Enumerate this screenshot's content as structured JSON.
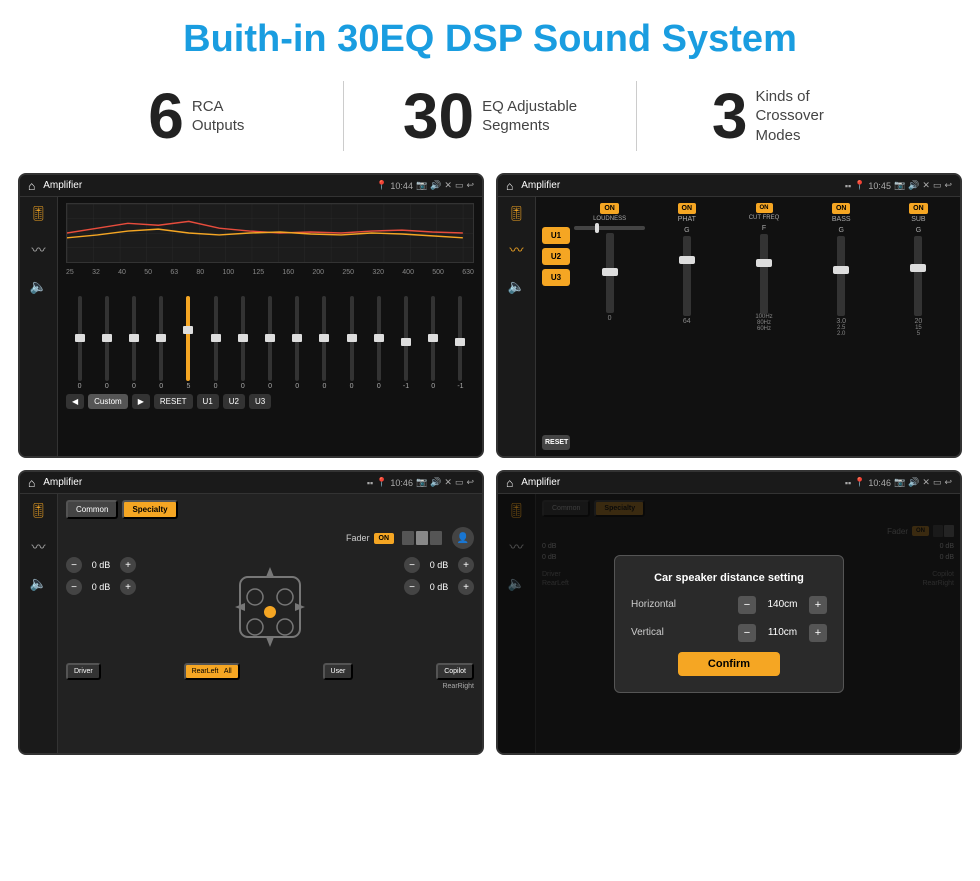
{
  "header": {
    "title": "Buith-in 30EQ DSP Sound System"
  },
  "stats": [
    {
      "number": "6",
      "label": "RCA\nOutputs"
    },
    {
      "number": "30",
      "label": "EQ Adjustable\nSegments"
    },
    {
      "number": "3",
      "label": "Kinds of\nCrossover Modes"
    }
  ],
  "screens": [
    {
      "id": "eq-screen",
      "statusBar": {
        "title": "Amplifier",
        "time": "10:44"
      },
      "type": "eq"
    },
    {
      "id": "mixer-screen",
      "statusBar": {
        "title": "Amplifier",
        "time": "10:45"
      },
      "type": "mixer"
    },
    {
      "id": "fader-screen",
      "statusBar": {
        "title": "Amplifier",
        "time": "10:46"
      },
      "type": "fader"
    },
    {
      "id": "dialog-screen",
      "statusBar": {
        "title": "Amplifier",
        "time": "10:46"
      },
      "type": "dialog",
      "dialog": {
        "title": "Car speaker distance setting",
        "horizontal": {
          "label": "Horizontal",
          "value": "140cm"
        },
        "vertical": {
          "label": "Vertical",
          "value": "110cm"
        },
        "confirmLabel": "Confirm"
      }
    }
  ],
  "eq": {
    "freqLabels": [
      "25",
      "32",
      "40",
      "50",
      "63",
      "80",
      "100",
      "125",
      "160",
      "200",
      "250",
      "320",
      "400",
      "500",
      "630"
    ],
    "values": [
      "0",
      "0",
      "0",
      "0",
      "5",
      "0",
      "0",
      "0",
      "0",
      "0",
      "0",
      "0",
      "-1",
      "0",
      "-1"
    ],
    "presets": [
      "Custom",
      "RESET",
      "U1",
      "U2",
      "U3"
    ],
    "sliderPositions": [
      50,
      50,
      50,
      50,
      40,
      50,
      50,
      50,
      50,
      50,
      50,
      50,
      55,
      50,
      55
    ]
  },
  "mixer": {
    "presets": [
      "U1",
      "U2",
      "U3"
    ],
    "channels": [
      {
        "label": "LOUDNESS",
        "on": true
      },
      {
        "label": "PHAT",
        "on": true
      },
      {
        "label": "CUT FREQ",
        "on": true
      },
      {
        "label": "BASS",
        "on": true
      },
      {
        "label": "SUB",
        "on": true
      }
    ],
    "resetLabel": "RESET"
  },
  "fader": {
    "tabs": [
      "Common",
      "Specialty"
    ],
    "faderLabel": "Fader",
    "faderOn": "ON",
    "controls": [
      {
        "value": "0 dB"
      },
      {
        "value": "0 dB"
      },
      {
        "value": "0 dB"
      },
      {
        "value": "0 dB"
      }
    ],
    "buttons": [
      "Driver",
      "RearLeft",
      "All",
      "User",
      "Copilot",
      "RearRight"
    ]
  },
  "dialog": {
    "title": "Car speaker distance setting",
    "horizontalLabel": "Horizontal",
    "horizontalValue": "140cm",
    "verticalLabel": "Vertical",
    "verticalValue": "110cm",
    "confirmLabel": "Confirm",
    "dbValues": [
      "0 dB",
      "0 dB"
    ]
  }
}
